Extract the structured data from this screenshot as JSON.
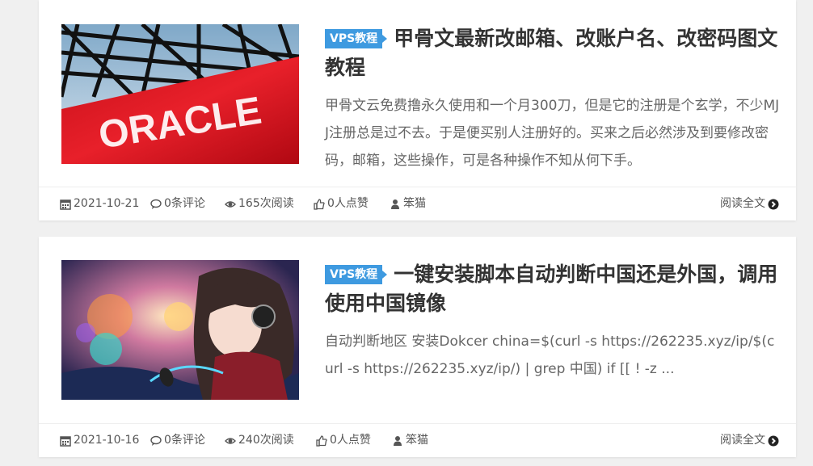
{
  "posts": [
    {
      "tag": "VPS教程",
      "title": "甲骨文最新改邮箱、改账户名、改密码图文教程",
      "excerpt": "甲骨文云免费撸永久使用和一个月300刀，但是它的注册是个玄学，不少MJJ注册总是过不去。于是便买别人注册好的。买来之后必然涉及到要修改密码，邮箱，这些操作，可是各种操作不知从何下手。",
      "thumb_text": "ORACLE",
      "date": "2021-10-21",
      "comments": "0条评论",
      "views": "165次阅读",
      "likes": "0人点赞",
      "author": "笨猫",
      "read_more": "阅读全文"
    },
    {
      "tag": "VPS教程",
      "title": "一键安装脚本自动判断中国还是外国，调用使用中国镜像",
      "excerpt": "自动判断地区 安装Dokcer china=$(curl -s https://262235.xyz/ip/$(curl -s https://262235.xyz/ip/) | grep 中国) if [[ ! -z ...",
      "date": "2021-10-16",
      "comments": "0条评论",
      "views": "240次阅读",
      "likes": "0人点赞",
      "author": "笨猫",
      "read_more": "阅读全文"
    }
  ],
  "icons": {
    "date": "calendar-icon",
    "comments": "comment-icon",
    "views": "eye-icon",
    "likes": "thumbs-up-icon",
    "author": "user-icon",
    "read_more": "arrow-circle-right-icon"
  },
  "colors": {
    "tag_bg": "#3e9ae0",
    "title": "#333333",
    "excerpt": "#666666",
    "oracle_red": "#e01b23"
  }
}
